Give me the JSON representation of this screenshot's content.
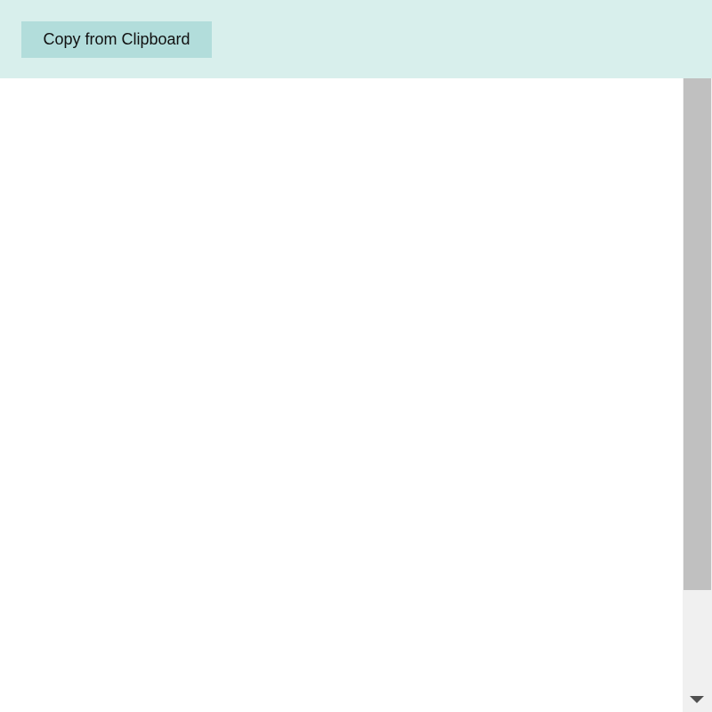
{
  "toolbar": {
    "copy_label": "Copy from Clipboard"
  },
  "colors": {
    "toolbar_background": "#d8efec",
    "button_background": "#b2dddb",
    "content_background": "#ffffff",
    "scrollbar_track": "#f0f0f0",
    "scrollbar_thumb": "#c0c0c0"
  },
  "icons": {
    "scroll_down": "chevron-down-icon"
  }
}
